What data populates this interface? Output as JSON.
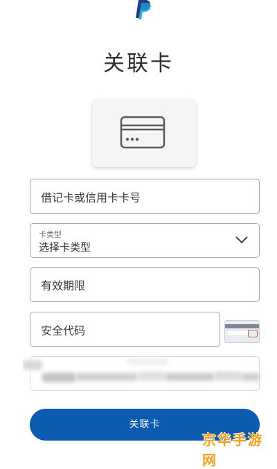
{
  "header": {
    "logo": "paypal-logo",
    "title": "关联卡"
  },
  "card_tile": {
    "icon": "credit-card-icon"
  },
  "form": {
    "card_number_placeholder": "借记卡或信用卡卡号",
    "card_type_label": "卡类型",
    "card_type_value": "选择卡类型",
    "expiry_placeholder": "有效期限",
    "security_code_placeholder": "安全代码",
    "cvv_icon": "card-security-code-icon"
  },
  "submit_label": "关联卡",
  "watermark": "京华手游网",
  "colors": {
    "button": "#0d5bb0",
    "border": "#9da3a6",
    "watermark": "#f0a21a"
  }
}
